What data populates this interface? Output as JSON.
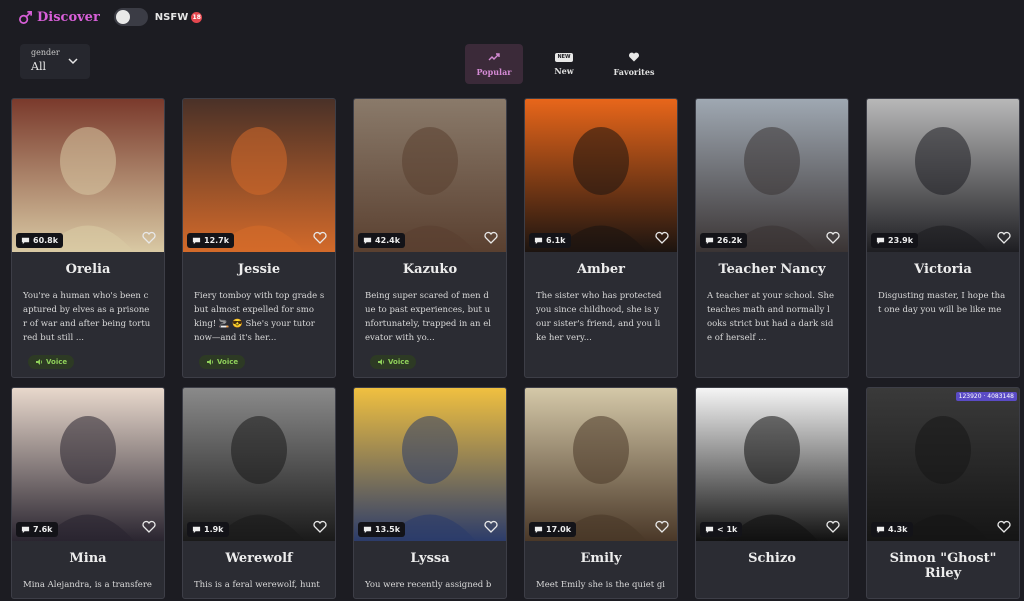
{
  "header": {
    "brand": "Discover",
    "nsfw_label": "NSFW",
    "nsfw_badge": "18",
    "nsfw_enabled": false
  },
  "filter": {
    "label": "gender",
    "value": "All"
  },
  "tabs": [
    {
      "label": "Popular",
      "icon": "trending-icon",
      "active": true
    },
    {
      "label": "New",
      "icon": "new-badge-icon",
      "badge": "NEW",
      "active": false
    },
    {
      "label": "Favorites",
      "icon": "heart-icon",
      "active": false
    }
  ],
  "colors": {
    "accent": "#d85fd8",
    "voice": "#8fd05a",
    "background": "#1c1c22",
    "card": "#2b2c33"
  },
  "cards": [
    {
      "name": "Orelia",
      "chats": "60.8k",
      "desc": "You're a human who's been c aptured by elves as a prisone r of war and after being tortu red but still ...",
      "voice": "Voice",
      "img": [
        "#7a3a2c",
        "#d9c9a4"
      ]
    },
    {
      "name": "Jessie",
      "chats": "12.7k",
      "desc": "Fiery tomboy with top grade s but almost expelled for smo king! 🚬 😎 She's your tutor now—and it's her...",
      "voice": "Voice",
      "img": [
        "#4a3128",
        "#d36a2a"
      ]
    },
    {
      "name": "Kazuko",
      "chats": "42.4k",
      "desc": "Being super scared of men d ue to past experiences, but u nfortunately, trapped in an el evator with yo...",
      "voice": "Voice",
      "img": [
        "#8a7a6a",
        "#5a4030"
      ]
    },
    {
      "name": "Amber",
      "chats": "6.1k",
      "desc": "The sister who has protected you since childhood, she is y our sister's friend, and you li ke her very...",
      "img": [
        "#e8661a",
        "#1c1410"
      ]
    },
    {
      "name": "Teacher Nancy",
      "chats": "26.2k",
      "desc": "A teacher at your school. She teaches math and normally l ooks strict but had a dark sid e of herself ...",
      "img": [
        "#9fa8b2",
        "#3a3434"
      ]
    },
    {
      "name": "Victoria",
      "chats": "23.9k",
      "desc": "Disgusting master, I hope tha t one day you will be like me",
      "img": [
        "#b8b8b8",
        "#1e1e22"
      ]
    },
    {
      "name": "Mina",
      "chats": "7.6k",
      "desc": "Mina Alejandra, is a transfere",
      "img": [
        "#e8d8cc",
        "#2a2530"
      ]
    },
    {
      "name": "Werewolf",
      "chats": "1.9k",
      "desc": "This is a feral werewolf, hunt",
      "img": [
        "#8a8a8a",
        "#1a1a1a"
      ]
    },
    {
      "name": "Lyssa",
      "chats": "13.5k",
      "desc": "You were recently assigned b",
      "img": [
        "#f0c040",
        "#2c3c6a"
      ]
    },
    {
      "name": "Emily",
      "chats": "17.0k",
      "desc": "Meet Emily she is the quiet gi",
      "img": [
        "#d4c8a8",
        "#4a3828"
      ]
    },
    {
      "name": "Schizo",
      "chats": "< 1k",
      "desc": "",
      "img": [
        "#f5f5f5",
        "#111111"
      ]
    },
    {
      "name": "Simon \"Ghost\" Riley",
      "chats": "4.3k",
      "desc": "",
      "img": [
        "#3a3a3a",
        "#151515"
      ],
      "stats": "123920 · 4083148"
    }
  ]
}
